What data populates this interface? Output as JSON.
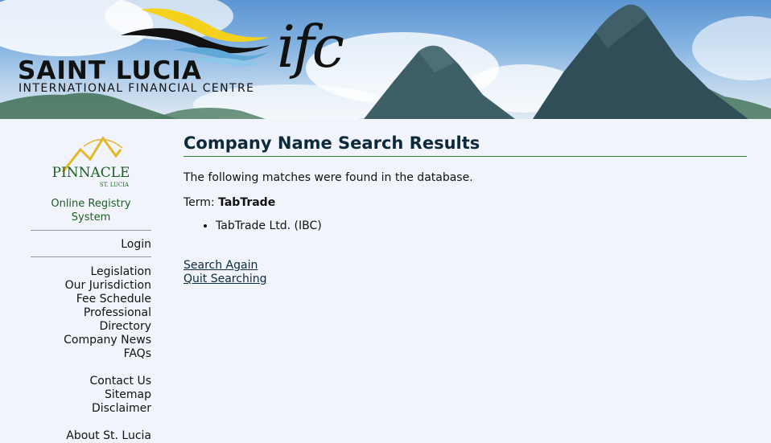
{
  "header": {
    "logo_main": "SAINT LUCIA",
    "logo_sub": "INTERNATIONAL FINANCIAL CENTRE",
    "logo_ifc": "ifc"
  },
  "sidebar": {
    "pinnacle_name": "PINNACLE",
    "pinnacle_sub": "ST. LUCIA",
    "registry_label": "Online Registry System",
    "login": "Login",
    "nav_primary": [
      "Legislation",
      "Our Jurisdiction",
      "Fee Schedule",
      "Professional Directory",
      "Company News",
      "FAQs"
    ],
    "nav_secondary": [
      "Contact Us",
      "Sitemap",
      "Disclaimer"
    ],
    "nav_tertiary": [
      "About St. Lucia"
    ]
  },
  "main": {
    "title": "Company Name Search Results",
    "intro": "The following matches were found in the database.",
    "term_label": "Term:",
    "term_value": "TabTrade",
    "results": [
      "TabTrade Ltd. (IBC)"
    ],
    "search_again": "Search Again",
    "quit_searching": "Quit Searching"
  },
  "colors": {
    "page_background": "#f1f5fb",
    "heading": "#0c2a3c",
    "heading_rule": "#2e7d32",
    "registry_text": "#1b5e20"
  }
}
